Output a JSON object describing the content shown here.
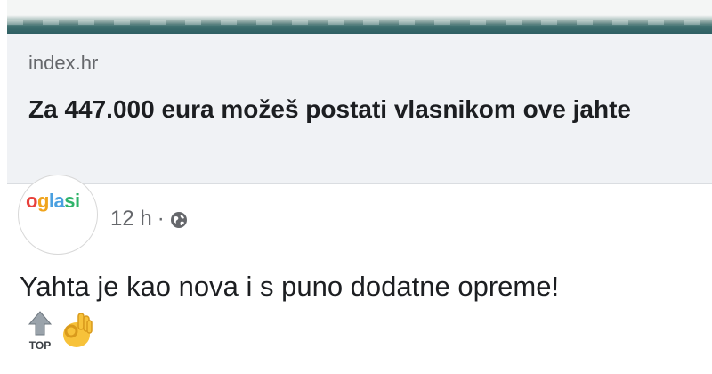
{
  "link_preview": {
    "domain": "index.hr",
    "title": "Za 447.000 eura možeš postati vlasnikom ove jahte"
  },
  "post": {
    "page_logo_text": [
      "o",
      "g",
      "la",
      "si"
    ],
    "timestamp": "12 h",
    "separator": "·",
    "privacy_icon": "globe-icon",
    "text": "Yahta je kao nova i s puno dodatne opreme!",
    "emojis": [
      "top-arrow-icon",
      "ok-hand-icon"
    ],
    "top_label": "TOP"
  },
  "colors": {
    "card_background": "#f0f2f5",
    "secondary_text": "#65676b",
    "primary_text": "#1c1e21"
  }
}
